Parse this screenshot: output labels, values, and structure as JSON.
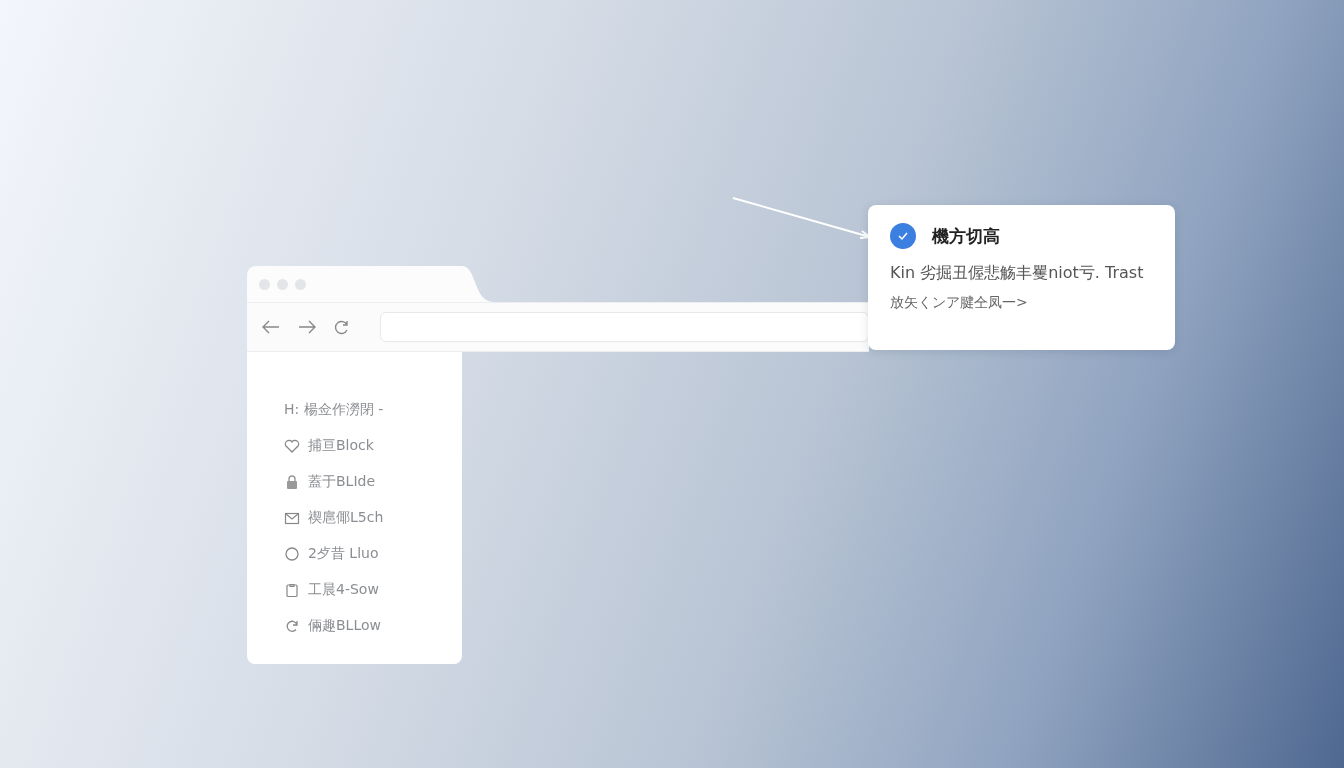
{
  "browser": {
    "sidebar": {
      "items": [
        {
          "label": "H: 楊佥作澇閉 -"
        },
        {
          "label": "捕亘Block"
        },
        {
          "label": "蓋于BLIde"
        },
        {
          "label": "禊扈倻L5ch"
        },
        {
          "label": "2歺昔 Lluo"
        },
        {
          "label": "工晨4-Sow"
        },
        {
          "label": "倆趣BLLow"
        }
      ]
    }
  },
  "popup": {
    "title": "機方切高",
    "message": "Kin 劣掘丑偓悲觞丰矍niot亏. Trast",
    "link": "放矢くンア腱仝凤一>"
  }
}
